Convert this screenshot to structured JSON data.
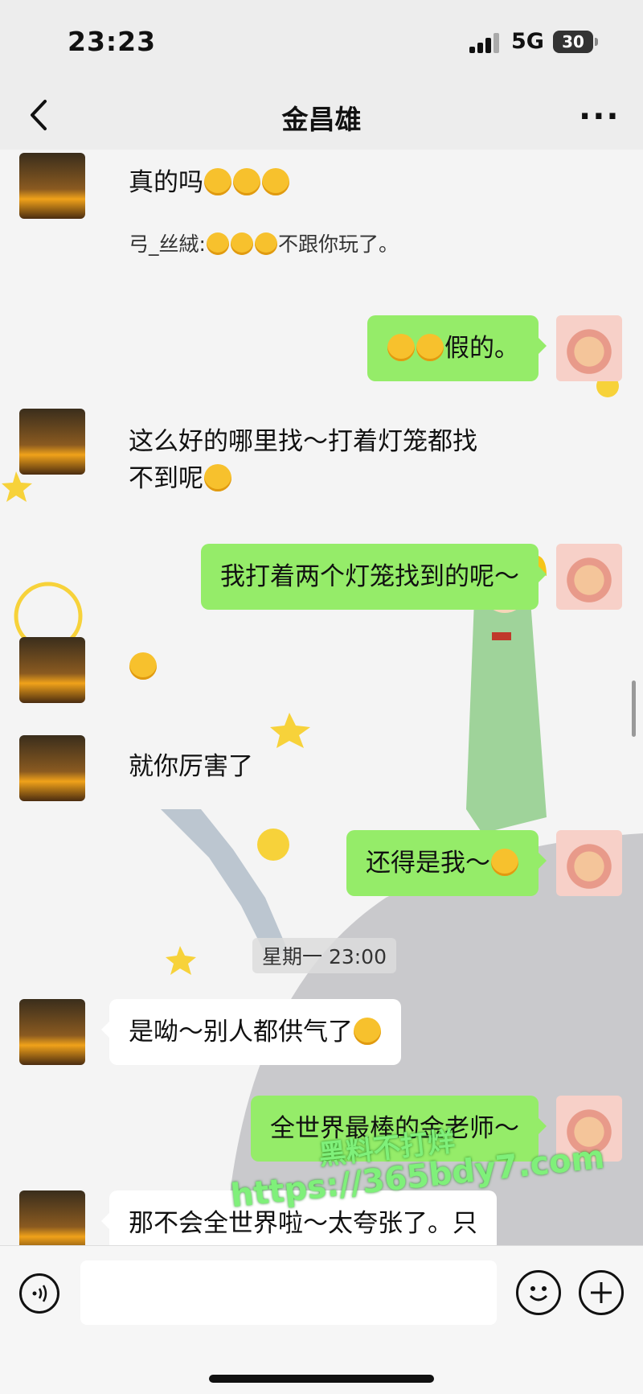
{
  "status_bar": {
    "time": "23:23",
    "network": "5G",
    "battery": "30"
  },
  "nav": {
    "title": "金昌雄"
  },
  "messages": [
    {
      "side": "left",
      "text": "真的吗",
      "emoji": [
        "cry-emoji",
        "cry-emoji",
        "cry-emoji"
      ]
    },
    {
      "side": "left",
      "quote_label": "弓_丝絨:",
      "quote_text": "不跟你玩了。",
      "quote_emoji": [
        "question-emoji",
        "question-emoji",
        "question-emoji"
      ]
    },
    {
      "side": "right",
      "text": "假的。",
      "emoji": [
        "question-emoji",
        "question-emoji"
      ]
    },
    {
      "side": "left",
      "text_line1": "这么好的哪里找～打着灯笼都找",
      "text_line2": "不到呢",
      "emoji": [
        "grin-emoji"
      ]
    },
    {
      "side": "right",
      "text": "我打着两个灯笼找到的呢～"
    },
    {
      "side": "left",
      "emoji": [
        "wink-emoji"
      ]
    },
    {
      "side": "left",
      "text": "就你厉害了"
    },
    {
      "side": "right",
      "text": "还得是我～",
      "emoji": [
        "grin-emoji"
      ]
    },
    {
      "side": "left",
      "text": "是呦～别人都供气了",
      "emoji": [
        "thinking-emoji"
      ]
    },
    {
      "side": "right",
      "text": "全世界最棒的金老师～"
    },
    {
      "side": "left",
      "text": "那不会全世界啦～太夸张了。只"
    }
  ],
  "timestamp": "星期一 23:00",
  "watermark": {
    "line1": "黑料不打烊",
    "line2": "https://365bdy7.com"
  },
  "input_bar": {
    "voice_icon": "voice-icon",
    "emoji_icon": "emoji-icon",
    "plus_icon": "plus-icon"
  },
  "colors": {
    "bubble_self": "#95ec69",
    "bubble_other": "#ffffff",
    "bar_bg": "#ededed"
  }
}
